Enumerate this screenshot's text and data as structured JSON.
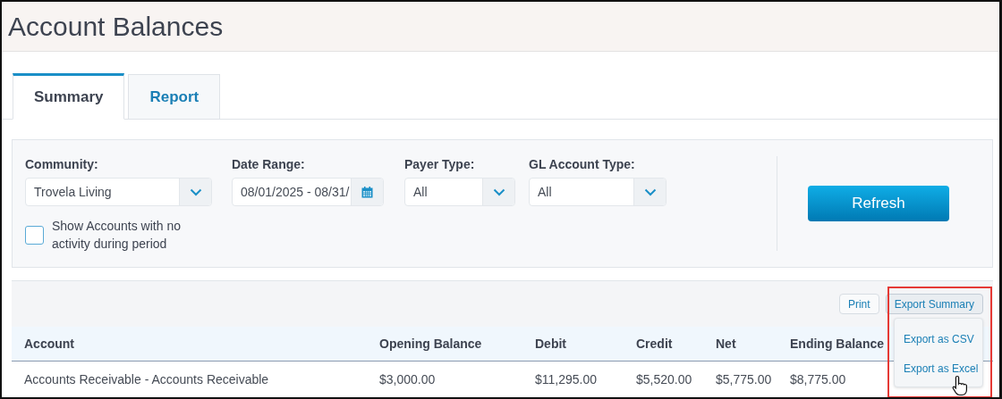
{
  "page": {
    "title": "Account Balances"
  },
  "tabs": [
    {
      "label": "Summary",
      "selected": true
    },
    {
      "label": "Report",
      "selected": false
    }
  ],
  "filters": {
    "fields": [
      {
        "label": "Community:",
        "value": "Trovela Living",
        "kind": "select"
      },
      {
        "label": "Date Range:",
        "value": "08/01/2025 - 08/31/",
        "kind": "date"
      },
      {
        "label": "Payer Type:",
        "value": "All",
        "kind": "select"
      },
      {
        "label": "GL Account Type:",
        "value": "All",
        "kind": "select"
      }
    ],
    "checkbox": {
      "label": "Show Accounts with no activity during period",
      "checked": false
    },
    "refresh_button": "Refresh"
  },
  "toolbar": {
    "print_button": "Print",
    "export_button": "Export Summary",
    "export_highlighted": true,
    "export_menu": {
      "expanded": true,
      "items": [
        "Export as CSV",
        "Export as Excel"
      ]
    }
  },
  "table": {
    "columns": [
      "Account",
      "Opening Balance",
      "Debit",
      "Credit",
      "Net",
      "Ending Balance"
    ],
    "rows": [
      [
        "Accounts Receivable - Accounts Receivable",
        "$3,000.00",
        "$11,295.00",
        "$5,520.00",
        "$5,775.00",
        "$8,775.00"
      ]
    ]
  }
}
